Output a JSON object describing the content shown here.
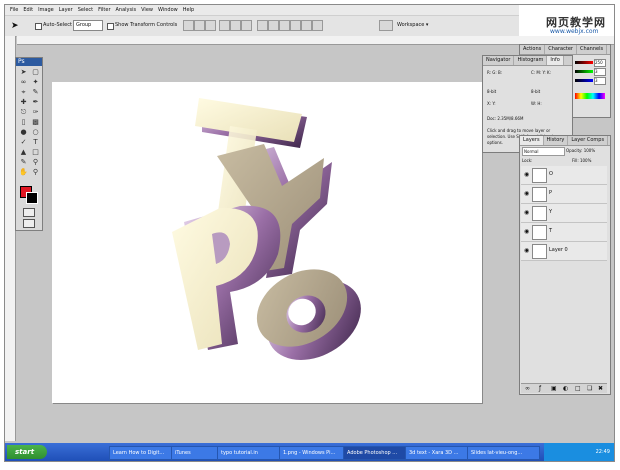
{
  "menu": [
    "File",
    "Edit",
    "Image",
    "Layer",
    "Select",
    "Filter",
    "Analysis",
    "View",
    "Window",
    "Help"
  ],
  "options": {
    "auto_select_label": "Auto-Select",
    "auto_select_value": "Group",
    "show_transform_label": "Show Transform Controls",
    "workspace_label": "Workspace ▾"
  },
  "brand": {
    "title": "网页教学网",
    "url": "www.webjx.com"
  },
  "toolbox": {
    "header": "Ps"
  },
  "color_panel": {
    "tabs": [
      "Actions",
      "Character",
      "Channels"
    ],
    "values": [
      "250",
      "3",
      "3"
    ]
  },
  "info_panel": {
    "tabs": [
      "Navigator",
      "Histogram",
      "Info"
    ],
    "rows": [
      "R: G: B:",
      "C: M: Y: K:",
      "8-bit",
      "8-bit",
      "X: Y:",
      "W: H:"
    ],
    "doc": "Doc: 2.35M/8.66M",
    "hint": "Click and drag to move layer or selection. Use Shift for additional options."
  },
  "layers_panel": {
    "tabs": [
      "Layers",
      "History",
      "Layer Comps"
    ],
    "blend": "Normal",
    "opacity_label": "Opacity: 100%",
    "lock_label": "Lock:",
    "fill_label": "Fill: 100%",
    "layers": [
      {
        "name": "O"
      },
      {
        "name": "P"
      },
      {
        "name": "Y"
      },
      {
        "name": "T"
      },
      {
        "name": "Layer 0"
      }
    ]
  },
  "artwork": {
    "letters": [
      "T",
      "Y",
      "P",
      "O"
    ]
  },
  "taskbar": {
    "start": "start",
    "tasks": [
      "Learn How to Digit...",
      "iTunes",
      "typo tutorial.in",
      "1.png - Windows Pi...",
      "Adobe Photoshop ...",
      "3d text - Xara 3D ...",
      "Slides lat-vieu-ong..."
    ],
    "clock": "22:49"
  }
}
